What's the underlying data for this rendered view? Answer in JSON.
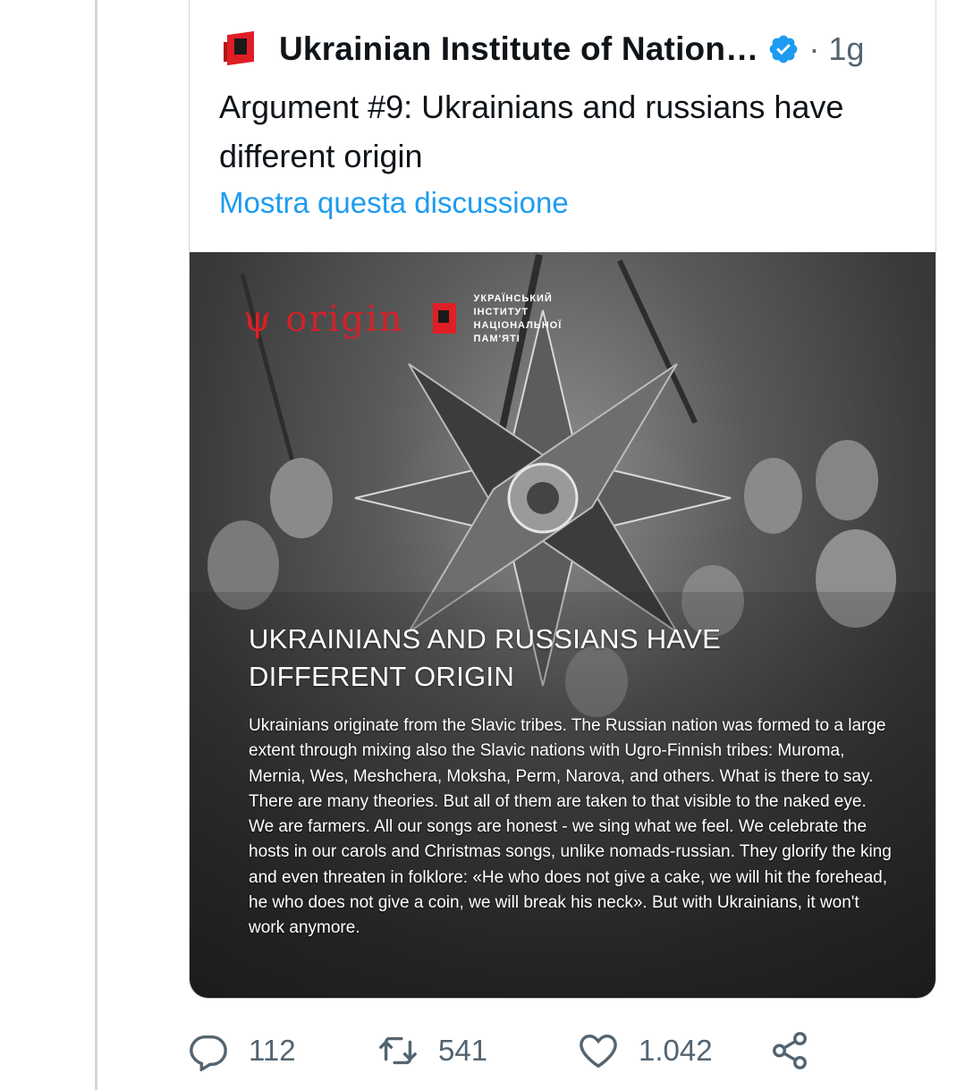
{
  "tweet": {
    "author_name": "Ukrainian Institute of Nation…",
    "timestamp": "· 1g",
    "text": "Argument #9: Ukrainians and russians have different origin",
    "show_thread": "Mostra questa discussione"
  },
  "media": {
    "logo_origin": "origin",
    "trident": "ψ",
    "institute_name": "УКРАЇНСЬКИЙ ІНСТИТУТ НАЦІОНАЛЬНОЇ ПАМ'ЯТІ",
    "headline": "UKRAINIANS AND RUSSIANS HAVE DIFFERENT ORIGIN",
    "body": "Ukrainians originate from the Slavic tribes. The Russian nation was formed to a large extent through mixing also the Slavic nations with Ugro-Finnish tribes: Muroma, Mernia, Wes, Meshchera, Moksha, Perm, Narova, and others. What is there to say. There are many theories. But all of them are taken to that visible to the naked eye. We are farmers. All our songs are honest - we sing what we feel. We celebrate the hosts in our carols and Christmas songs, unlike nomads-russian. They glorify the king and even threaten in folklore: «He who does not give a cake, we will hit the forehead, he who does not give a coin, we will break his neck». But with Ukrainians, it won't work anymore."
  },
  "actions": {
    "replies": "112",
    "retweets": "541",
    "likes": "1.042"
  },
  "icons": {
    "reply": "reply-icon",
    "retweet": "retweet-icon",
    "like": "heart-icon",
    "share": "share-icon",
    "verified": "verified-badge-icon"
  },
  "colors": {
    "accent": "#1d9bf0",
    "brand_red": "#e01e25",
    "text_primary": "#0f1419",
    "text_secondary": "#536471"
  }
}
